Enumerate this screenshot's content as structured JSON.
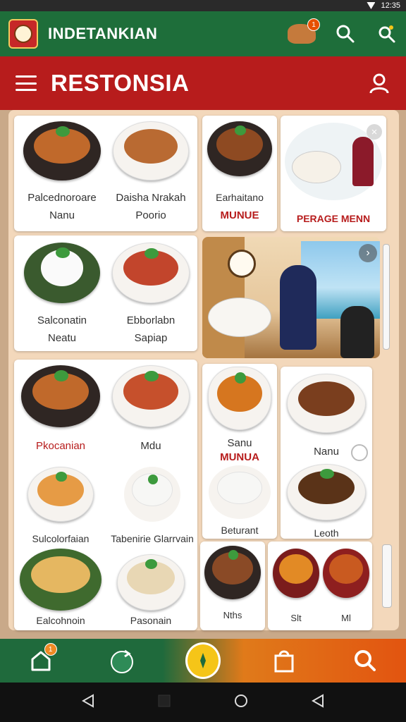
{
  "status": {
    "time": "12:35"
  },
  "appbar": {
    "title": "INDETANKIAN",
    "cart_badge": "1",
    "icons": [
      "logo-icon",
      "food-cart-icon",
      "search-icon",
      "settings-icon"
    ]
  },
  "header": {
    "title": "RESTONSIA",
    "icons": [
      "hamburger-menu-icon",
      "user-icon"
    ]
  },
  "menu": {
    "row1": [
      {
        "line1": "Palcednoroare",
        "line2": "Nanu"
      },
      {
        "line1": "Daisha Nrakah",
        "line2": "Poorio"
      },
      {
        "line1": "Earhaitano",
        "line2": "MUNUE"
      },
      {
        "line1": "PERAGE MENN"
      }
    ],
    "row2": [
      {
        "line1": "Salconatin",
        "line2": "Neatu"
      },
      {
        "line1": "Ebborlabn",
        "line2": "Sapiap"
      }
    ],
    "grid": [
      {
        "line1": "Pkocanian"
      },
      {
        "line1": "Mdu"
      },
      {
        "line1": "Sanu",
        "line2": "MUNUA"
      },
      {
        "line1": "Nanu"
      },
      {
        "line1": "Sulcolorfaian"
      },
      {
        "line1": "Tabenirie Glarrvain"
      },
      {
        "line1": "Beturant"
      },
      {
        "line1": "Leoth"
      },
      {
        "line1": "Ealcohnoin"
      },
      {
        "line1": "Pasonain"
      },
      {
        "line1": "Nths"
      },
      {
        "line1": "Slt"
      },
      {
        "line1": "Ml"
      }
    ]
  },
  "bottom_nav": {
    "home_badge": "1",
    "items": [
      "home-icon",
      "dine-icon",
      "compass-icon",
      "bag-icon",
      "search-icon"
    ]
  },
  "colors": {
    "green": "#1e6e3a",
    "red": "#b71c1c",
    "orange": "#e25410",
    "panel": "#f3d8bb"
  }
}
